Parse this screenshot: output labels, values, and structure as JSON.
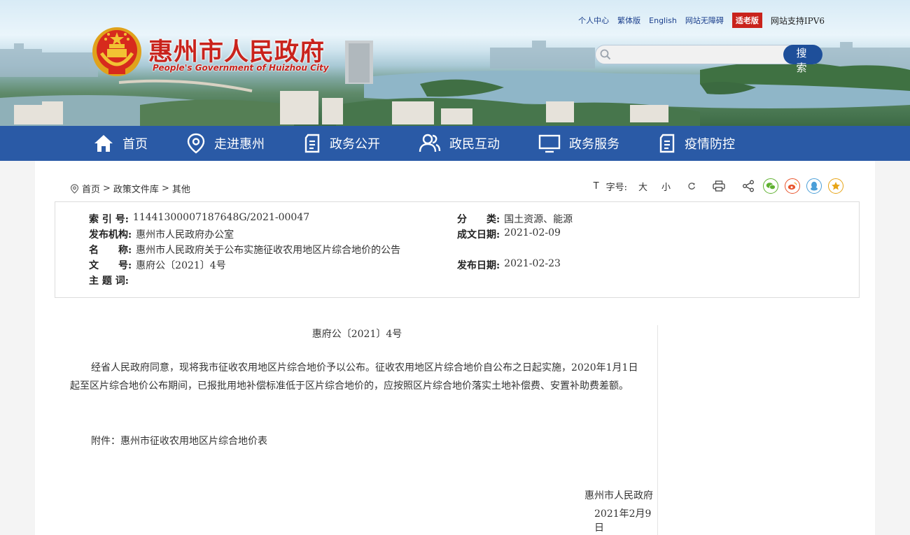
{
  "header": {
    "top_links": [
      "个人中心",
      "繁体版",
      "English",
      "网站无障碍"
    ],
    "elder_mode": "适老版",
    "ipv6": "网站支持IPV6",
    "site_title": "惠州市人民政府",
    "site_subtitle": "People's Government of Huizhou City",
    "search_placeholder": "",
    "search_button": "搜 索"
  },
  "nav": {
    "items": [
      {
        "label": "首页",
        "icon": "home-icon"
      },
      {
        "label": "走进惠州",
        "icon": "location-pin-icon"
      },
      {
        "label": "政务公开",
        "icon": "document-icon"
      },
      {
        "label": "政民互动",
        "icon": "people-icon"
      },
      {
        "label": "政务服务",
        "icon": "monitor-icon"
      },
      {
        "label": "疫情防控",
        "icon": "document-icon"
      }
    ]
  },
  "breadcrumb": {
    "items": [
      "首页",
      "政策文件库",
      "其他"
    ],
    "separator": ">"
  },
  "toolbar": {
    "font_label": "字号:",
    "font_large": "大",
    "font_small": "小",
    "share_icons": [
      "wechat-icon",
      "weibo-icon",
      "qq-icon",
      "favorite-icon"
    ],
    "colors": {
      "wechat": "#5fb130",
      "weibo": "#e8542c",
      "qq": "#4b9fd8",
      "favorite": "#e7a416"
    }
  },
  "meta": {
    "index_label": "索 引 号:",
    "index_value": "11441300007187648G/2021-00047",
    "category_label": "分　　类:",
    "category_value": "国土资源、能源",
    "issuer_label": "发布机构:",
    "issuer_value": "惠州市人民政府办公室",
    "written_label": "成文日期:",
    "written_value": "2021-02-09",
    "name_label": "名　　称:",
    "name_value": "惠州市人民政府关于公布实施征收农用地区片综合地价的公告",
    "docno_label": "文　　号:",
    "docno_value": "惠府公〔2021〕4号",
    "publish_label": "发布日期:",
    "publish_value": "2021-02-23",
    "subject_label": "主 题 词:",
    "subject_value": ""
  },
  "article": {
    "doc_number": "惠府公〔2021〕4号",
    "paragraph": "经省人民政府同意，现将我市征收农用地区片综合地价予以公布。征收农用地区片综合地价自公布之日起实施，2020年1月1日起至区片综合地价公布期间，已报批用地补偿标准低于区片综合地价的，应按照区片综合地价落实土地补偿费、安置补助费差额。",
    "attachment": "附件：惠州市征收农用地区片综合地价表",
    "signature": "惠州市人民政府",
    "date": "2021年2月9日"
  },
  "colors": {
    "nav_bg": "#2a5aa6",
    "brand_red": "#c9231c",
    "search_button": "#1e4f9a"
  }
}
